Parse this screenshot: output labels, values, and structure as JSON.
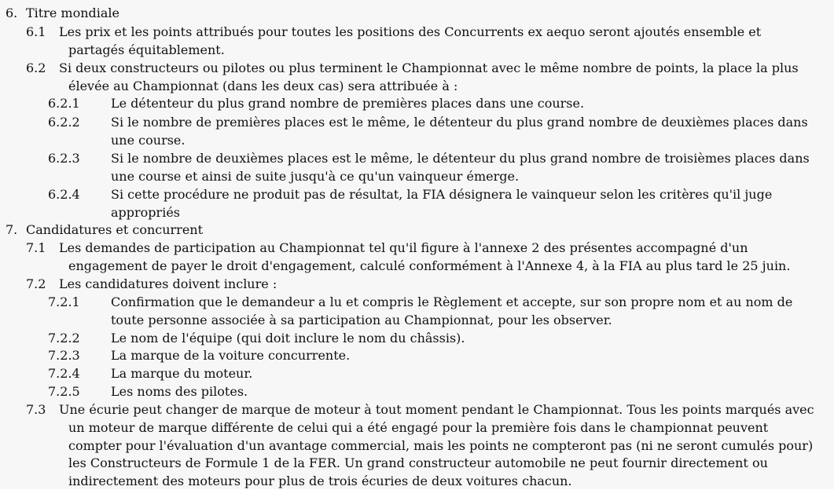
{
  "document": {
    "section6": {
      "number": "6.",
      "title": "Titre mondiale",
      "item_6_1": {
        "number": "6.1",
        "line1": "Les prix et les points attribués pour toutes les positions des Concurrents ex aequo seront ajoutés ensemble et",
        "line2": "partagés équitablement."
      },
      "item_6_2": {
        "number": "6.2",
        "line1": "Si deux constructeurs ou pilotes ou plus terminent le Championnat avec le même nombre de points, la place la plus",
        "line2": "élevée au Championnat (dans les deux cas) sera attribuée à :"
      },
      "item_6_2_1": {
        "number": "6.2.1",
        "line1": "Le détenteur du plus grand nombre de premières places dans une course."
      },
      "item_6_2_2": {
        "number": "6.2.2",
        "line1": "Si le nombre de premières places est le même, le détenteur du plus grand nombre de deuxièmes places dans",
        "line2": "une course."
      },
      "item_6_2_3": {
        "number": "6.2.3",
        "line1": "Si le nombre de deuxièmes places est le même, le détenteur du plus grand nombre de troisièmes places dans",
        "line2": "une course et ainsi de suite jusqu'à ce qu'un vainqueur émerge."
      },
      "item_6_2_4": {
        "number": "6.2.4",
        "line1": "Si cette procédure ne produit pas de résultat, la FIA désignera le vainqueur selon les critères qu'il juge",
        "line2": "appropriés"
      }
    },
    "section7": {
      "number": "7.",
      "title": "Candidatures et concurrent",
      "item_7_1": {
        "number": "7.1",
        "line1": "Les demandes de participation au Championnat tel qu'il figure à l'annexe 2 des présentes accompagné d'un",
        "line2": "engagement de payer le droit d'engagement, calculé conformément à l'Annexe 4, à la FIA au plus tard le 25 juin."
      },
      "item_7_2": {
        "number": "7.2",
        "line1": "Les candidatures doivent inclure :"
      },
      "item_7_2_1": {
        "number": "7.2.1",
        "line1": "Confirmation que le demandeur a lu et compris le Règlement et accepte, sur son propre nom et au nom de",
        "line2": "toute personne associée à sa participation au Championnat, pour les observer."
      },
      "item_7_2_2": {
        "number": "7.2.2",
        "line1": "Le nom de l'équipe (qui doit inclure le nom du châssis)."
      },
      "item_7_2_3": {
        "number": "7.2.3",
        "line1": "La marque de la voiture concurrente."
      },
      "item_7_2_4": {
        "number": "7.2.4",
        "line1": "La marque du moteur."
      },
      "item_7_2_5": {
        "number": "7.2.5",
        "line1": "Les noms des pilotes."
      },
      "item_7_3": {
        "number": "7.3",
        "line1": "Une écurie peut changer de marque de moteur à tout moment pendant le Championnat. Tous les points marqués avec",
        "line2": "un moteur de marque différente de celui qui a été engagé pour la première fois dans le championnat peuvent",
        "line3": "compter pour l'évaluation d'un avantage commercial, mais les points ne compteront pas (ni ne seront cumulés pour)",
        "line4": "les Constructeurs de Formule 1 de la FER. Un grand constructeur automobile ne peut fournir directement ou",
        "line5": "indirectement des moteurs pour plus de trois écuries de deux voitures chacun."
      }
    }
  }
}
